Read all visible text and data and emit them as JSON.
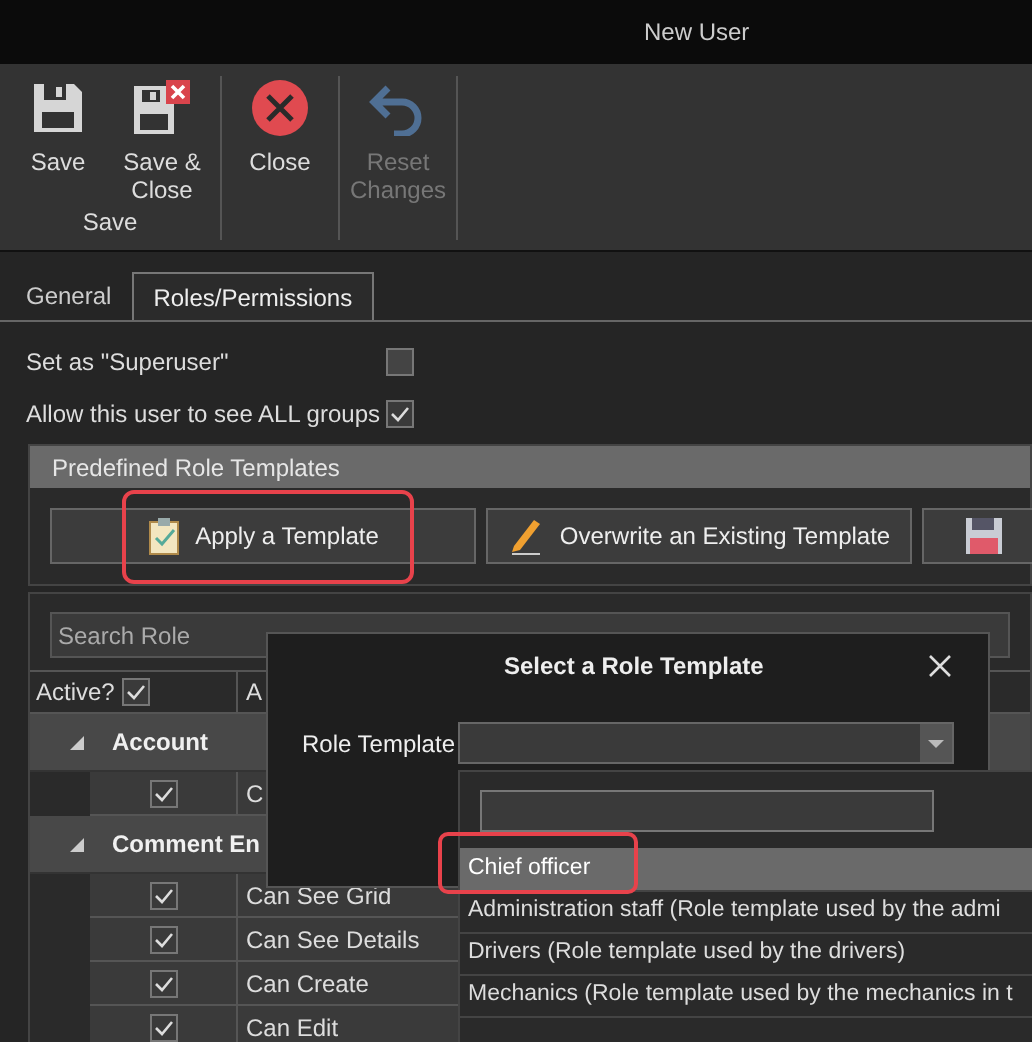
{
  "window": {
    "title": "New User"
  },
  "toolbar": {
    "groups": [
      {
        "label": "Save",
        "buttons": [
          {
            "label": "Save",
            "kind": "save",
            "disabled": false
          },
          {
            "label": "Save & Close",
            "kind": "save-close",
            "disabled": false
          }
        ]
      },
      {
        "buttons": [
          {
            "label": "Close",
            "kind": "close",
            "disabled": false
          }
        ]
      },
      {
        "buttons": [
          {
            "label": "Reset Changes",
            "kind": "reset",
            "disabled": true
          }
        ]
      }
    ]
  },
  "tabs": [
    {
      "label": "General",
      "selected": false
    },
    {
      "label": "Roles/Permissions",
      "selected": true
    }
  ],
  "options": [
    {
      "label": "Set as \"Superuser\"",
      "checked": false
    },
    {
      "label": "Allow this user to see ALL groups",
      "checked": true
    }
  ],
  "templates_panel": {
    "title": "Predefined Role Templates",
    "buttons": [
      {
        "label": "Apply a Template",
        "kind": "apply",
        "highlighted": true
      },
      {
        "label": "Overwrite an Existing Template",
        "kind": "overwrite",
        "highlighted": false
      },
      {
        "kind": "save",
        "highlighted": false
      }
    ]
  },
  "grid": {
    "search": {
      "placeholder": "Search Role"
    },
    "columns": [
      {
        "label": "Active?",
        "checked": true
      },
      {
        "label": "A"
      }
    ],
    "groups": [
      {
        "name": "Account",
        "expanded": true,
        "rows": [
          {
            "active": true,
            "permission": "C"
          }
        ]
      },
      {
        "name": "Comment En",
        "expanded": true,
        "rows": [
          {
            "active": true,
            "permission": "Can See Grid"
          },
          {
            "active": true,
            "permission": "Can See Details"
          },
          {
            "active": true,
            "permission": "Can Create"
          },
          {
            "active": true,
            "permission": "Can Edit"
          }
        ]
      }
    ]
  },
  "dialog": {
    "title": "Select a Role Template",
    "field": {
      "label": "Role Template"
    },
    "dropdown": {
      "open": true,
      "items": [
        {
          "label": "Chief officer",
          "selected": true,
          "highlighted": true
        },
        {
          "label": "Administration staff (Role template used by the admi",
          "selected": false,
          "highlighted": false
        },
        {
          "label": "Drivers (Role template used by the drivers)",
          "selected": false,
          "highlighted": false
        },
        {
          "label": "Mechanics (Role template used by the mechanics in t",
          "selected": false,
          "highlighted": false
        }
      ]
    }
  }
}
